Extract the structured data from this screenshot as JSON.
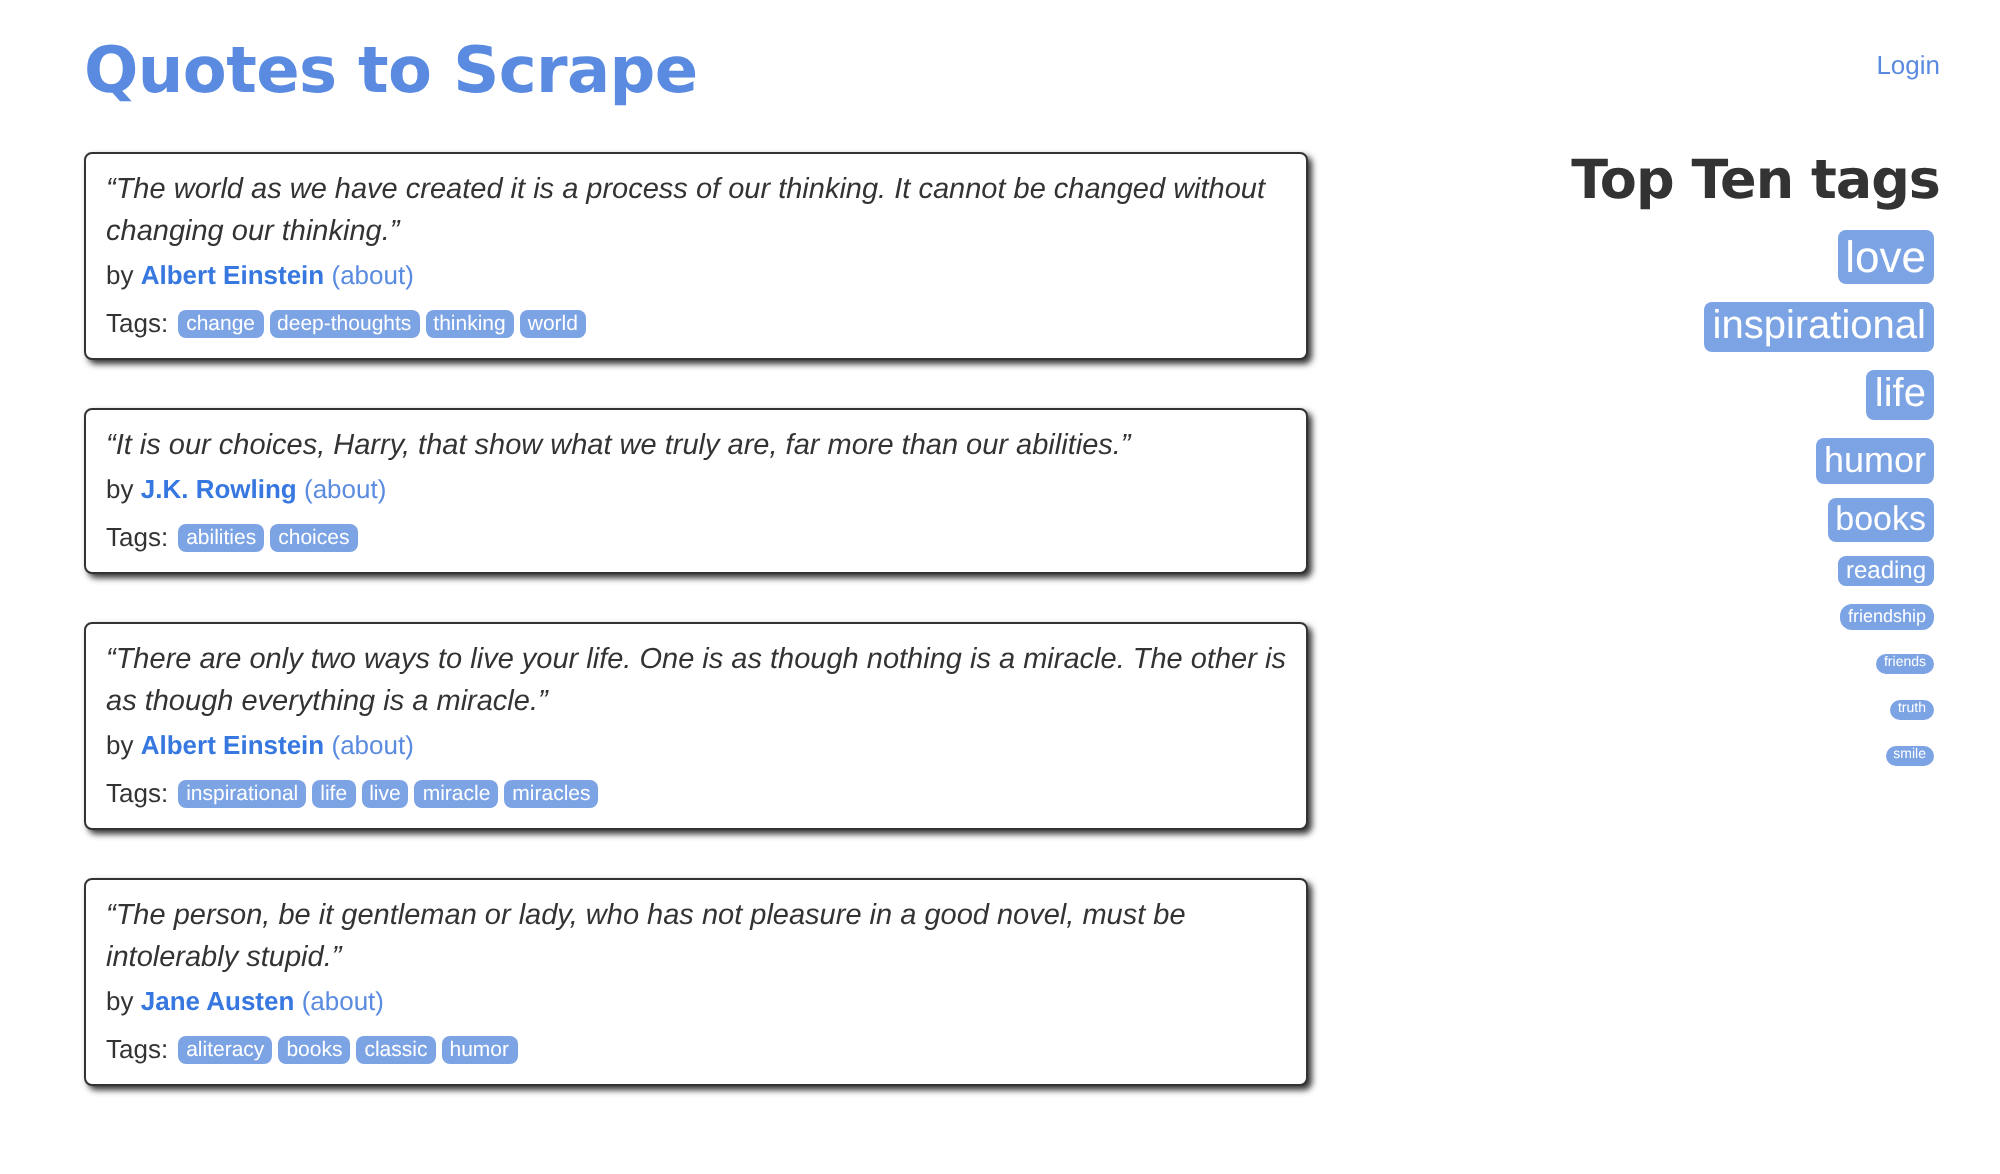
{
  "header": {
    "title": "Quotes to Scrape",
    "login": "Login"
  },
  "quotes": [
    {
      "text": "“The world as we have created it is a process of our thinking. It cannot be changed without changing our thinking.”",
      "by": "by",
      "author": "Albert Einstein",
      "about": "(about)",
      "tags_label": "Tags:",
      "tags": [
        "change",
        "deep-thoughts",
        "thinking",
        "world"
      ]
    },
    {
      "text": "“It is our choices, Harry, that show what we truly are, far more than our abilities.”",
      "by": "by",
      "author": "J.K. Rowling",
      "about": "(about)",
      "tags_label": "Tags:",
      "tags": [
        "abilities",
        "choices"
      ]
    },
    {
      "text": "“There are only two ways to live your life. One is as though nothing is a miracle. The other is as though everything is a miracle.”",
      "by": "by",
      "author": "Albert Einstein",
      "about": "(about)",
      "tags_label": "Tags:",
      "tags": [
        "inspirational",
        "life",
        "live",
        "miracle",
        "miracles"
      ]
    },
    {
      "text": "“The person, be it gentleman or lady, who has not pleasure in a good novel, must be intolerably stupid.”",
      "by": "by",
      "author": "Jane Austen",
      "about": "(about)",
      "tags_label": "Tags:",
      "tags": [
        "aliteracy",
        "books",
        "classic",
        "humor"
      ]
    }
  ],
  "sidebar": {
    "title": "Top Ten tags",
    "tags": [
      "love",
      "inspirational",
      "life",
      "humor",
      "books",
      "reading",
      "friendship",
      "friends",
      "truth",
      "smile"
    ]
  }
}
